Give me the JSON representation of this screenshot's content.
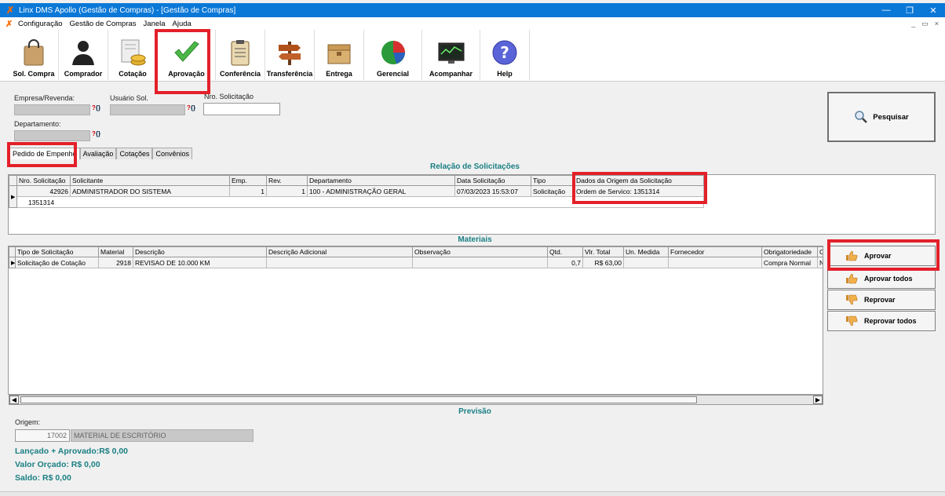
{
  "window": {
    "title": "Linx DMS Apollo (Gestão de Compras) - [Gestão de Compras]",
    "minimize": "—",
    "restore": "❐",
    "close": "✕"
  },
  "menu": {
    "items": [
      "Configuração",
      "Gestão de Compras",
      "Janela",
      "Ajuda"
    ],
    "mdi_min": "_",
    "mdi_restore": "▭",
    "mdi_close": "×"
  },
  "toolbar": {
    "sol_compra": "Sol. Compra",
    "comprador": "Comprador",
    "cotacao": "Cotação",
    "aprovacao": "Aprovação",
    "conferencia": "Conferência",
    "transferencia": "Transferência",
    "entrega": "Entrega",
    "gerencial": "Gerencial",
    "acompanhar": "Acompanhar",
    "help": "Help"
  },
  "filters": {
    "empresa_label": "Empresa/Revenda:",
    "usuario_label": "Usuário Sol.",
    "nro_label": "Nro. Solicitação",
    "departamento_label": "Departamento:",
    "lookup_q": "?",
    "lookup_b": "{}"
  },
  "search_button": "Pesquisar",
  "tabs": [
    "Pedido de Empenho",
    "Avaliação",
    "Cotações",
    "Convênios"
  ],
  "solicitacoes": {
    "title": "Relação de Solicitações",
    "columns": [
      "Nro. Solicitação",
      "Solicitante",
      "Emp.",
      "Rev.",
      "Departamento",
      "Data Solicitação",
      "Tipo",
      "Dados da Origem da Solicitação"
    ],
    "row": [
      "42926",
      "ADMINISTRADOR DO SISTEMA",
      "1",
      "1",
      "100 - ADMINISTRAÇÃO GERAL",
      "07/03/2023 15:53:07",
      "Solicitação",
      "Ordem de Servico: 1351314"
    ],
    "detail": "1351314"
  },
  "materiais": {
    "title": "Materiais",
    "columns": [
      "Tipo de Solicitação",
      "Material",
      "Descrição",
      "Descrição Adicional",
      "Observação",
      "Qtd.",
      "Vlr. Total",
      "Un. Medida",
      "Fornecedor",
      "Obrigatoriedade",
      "Co"
    ],
    "row": [
      "Solicitação de Cotação",
      "2918",
      "REVISAO DE 10.000 KM",
      "",
      "",
      "0,7",
      "R$ 63,00",
      "",
      "",
      "Compra Normal",
      "N"
    ]
  },
  "actions": {
    "aprovar": "Aprovar",
    "aprovar_todos": "Aprovar todos",
    "reprovar": "Reprovar",
    "reprovar_todos": "Reprovar todos"
  },
  "previsao": {
    "title": "Previsão",
    "origem_label": "Origem:",
    "origem_code": "17002",
    "origem_desc": "MATERIAL DE ESCRITÓRIO",
    "lancado": "Lançado + Aprovado:R$ 0,00",
    "valor_orcado": "Valor Orçado: R$ 0,00",
    "saldo": "Saldo: R$ 0,00"
  },
  "colors": {
    "accent_red": "#e3202a",
    "title_blue": "#0a78d7",
    "section_teal": "#1a7f83"
  },
  "icons": [
    "app-logo-icon",
    "shopping-bag-icon",
    "person-icon",
    "coins-icon",
    "checkmark-icon",
    "clipboard-icon",
    "signpost-icon",
    "box-icon",
    "pie-chart-icon",
    "monitor-chart-icon",
    "help-icon",
    "magnifier-icon",
    "thumbs-up-icon",
    "thumbs-down-icon"
  ]
}
